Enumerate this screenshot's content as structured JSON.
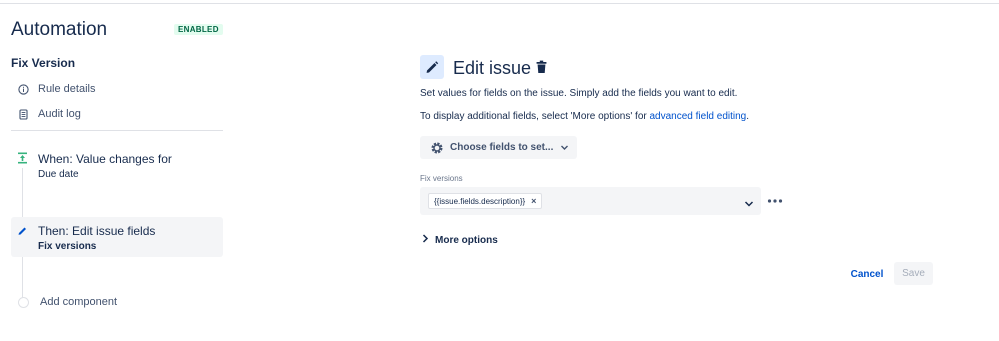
{
  "app": {
    "title": "Automation",
    "status": "ENABLED"
  },
  "rule": {
    "name": "Fix Version"
  },
  "sidebar": {
    "nav": [
      {
        "label": "Rule details",
        "icon": "info-icon"
      },
      {
        "label": "Audit log",
        "icon": "document-icon"
      }
    ],
    "components": [
      {
        "title": "When: Value changes for",
        "subtitle": "Due date",
        "icon": "trigger-icon"
      },
      {
        "title": "Then: Edit issue fields",
        "subtitle": "Fix versions",
        "icon": "pencil-icon"
      }
    ],
    "add_component": "Add component"
  },
  "panel": {
    "title": "Edit issue",
    "description_1": "Set values for fields on the issue. Simply add the fields you want to edit.",
    "description_2_prefix": "To display additional fields, select 'More options' for ",
    "description_2_link": "advanced field editing",
    "description_2_suffix": ".",
    "choose_fields_label": "Choose fields to set...",
    "field": {
      "label": "Fix versions",
      "tag_value": "{{issue.fields.description}}",
      "tag_remove": "×"
    },
    "more_options_label": "More options",
    "cancel_label": "Cancel",
    "save_label": "Save"
  },
  "colors": {
    "accent": "#0052cc",
    "enabled_bg": "#e3fcef",
    "enabled_text": "#006644",
    "trigger": "#36b37e",
    "selected_bg": "#f4f5f7"
  }
}
